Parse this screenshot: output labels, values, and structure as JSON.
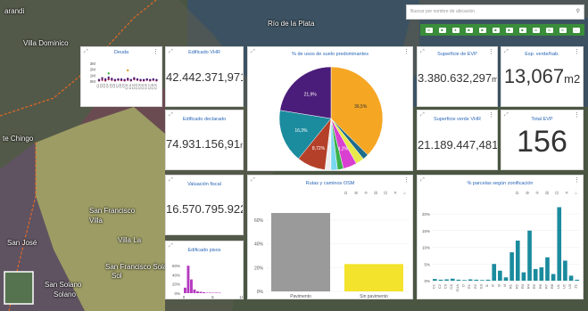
{
  "map": {
    "labels": {
      "villa_dominico": "Villa Dominico",
      "rio": "Río de la Plata",
      "tee_chingo": "te Chingo",
      "san_francisco": "San Francisco",
      "villa": "Villa",
      "arandi": "arandi",
      "san_jose": "San José",
      "villa_la": "Villa La",
      "san_francisco_solano": "San Francisco Solano",
      "san_solano": "San Solano",
      "solano": "Solano",
      "sol": "Sol"
    }
  },
  "search": {
    "placeholder": "Buscar por nombre de ubicación"
  },
  "toolbar": {
    "icons": [
      "chart-icon",
      "square-icon",
      "chat-icon",
      "square-icon",
      "square-icon",
      "square-icon",
      "square-icon",
      "square-icon",
      "chart-icon",
      "chart-icon",
      "chart-icon",
      "more-icon"
    ]
  },
  "widgets": {
    "deuda": {
      "title": "Deuda",
      "ylabels": [
        "3M",
        "2M",
        "1M",
        "0M"
      ],
      "xlabels": [
        "C1",
        "C2",
        "C3",
        "C4",
        "C5",
        "C6",
        "C7",
        "C8",
        "C9",
        "C10",
        "C11",
        "C12",
        "C13",
        "C14",
        "C15",
        "C16",
        "C17",
        "C18",
        "C19"
      ]
    },
    "edificado_vhr": {
      "title": "Edificado VHR",
      "value": "42.442.371,971",
      "unit": "m2"
    },
    "edificado_declarado": {
      "title": "Edificado declarado",
      "value": "74.931.156,91",
      "unit": "m2"
    },
    "valuacion_fiscal": {
      "title": "Valuación fiscal",
      "value": "16.570.795.922",
      "unit": "$"
    },
    "edificado_pisos": {
      "title": "Edificado pisos",
      "ylabels": [
        "60%",
        "40%",
        "20%",
        "0%"
      ],
      "xlabels": [
        "0",
        "5",
        "10"
      ]
    },
    "uso_suelo": {
      "title": "% de usos de suelo predominantes"
    },
    "superficie_evp": {
      "title": "Superficie de EVP",
      "value": "3.380.632,297",
      "unit": "m2"
    },
    "esp_verde": {
      "title": "Esp. verde/hab.",
      "value": "13,067",
      "unit": "m2"
    },
    "superficie_verde_vhr": {
      "title": "Superficie verde VHR",
      "value": "21.189.447,481",
      "unit": "m2"
    },
    "total_evp": {
      "title": "Total EVP",
      "value": "156"
    },
    "rutas": {
      "title": "Rutas y caminos OSM"
    },
    "parcelas": {
      "title": "% parcelas según zonificación"
    }
  },
  "chart_data": [
    {
      "type": "pie",
      "title": "% de usos de suelo predominantes",
      "slices": [
        {
          "label": "36,5%",
          "value": 36.5,
          "color": "#f5a623"
        },
        {
          "label": "",
          "value": 1.8,
          "color": "#1f6c8a"
        },
        {
          "label": "",
          "value": 2.5,
          "color": "#e8e84a"
        },
        {
          "label": "4,2%",
          "value": 4.2,
          "color": "#d93fd0"
        },
        {
          "label": "",
          "value": 1.8,
          "color": "#3bb04a"
        },
        {
          "label": "",
          "value": 2.0,
          "color": "#7ad7f0"
        },
        {
          "label": "",
          "value": 1.8,
          "color": "#eeeeee"
        },
        {
          "label": "8,72%",
          "value": 8.72,
          "color": "#b5402a"
        },
        {
          "label": "16,3%",
          "value": 16.3,
          "color": "#1b8b9e"
        },
        {
          "label": "21,9%",
          "value": 21.9,
          "color": "#4b1d7a"
        }
      ]
    },
    {
      "type": "bar",
      "title": "Rutas y caminos OSM",
      "categories": [
        "Pavimento",
        "Sin pavimento"
      ],
      "values": [
        66,
        23
      ],
      "colors": [
        "#9a9a9a",
        "#f4e32c"
      ],
      "yticks": [
        "0%",
        "20%",
        "40%",
        "60%"
      ],
      "ylim": [
        0,
        75
      ]
    },
    {
      "type": "bar",
      "title": "% parcelas según zonificación",
      "yticks": [
        "0%",
        "5%",
        "10%",
        "15%",
        "20%"
      ],
      "ylim": [
        0,
        24
      ],
      "categories": [
        "C1",
        "C2",
        "C3",
        "CA",
        "CUA",
        "D",
        "E1",
        "E2",
        "E3",
        "I1",
        "I2",
        "I3",
        "I4",
        "R1",
        "R2",
        "R3",
        "R4",
        "R5",
        "R6",
        "R7",
        "R8",
        "U1",
        "U2",
        "U3",
        "Z1"
      ],
      "values": [
        0.5,
        0.3,
        0.4,
        0.6,
        0.3,
        0.2,
        0.4,
        0.3,
        0.2,
        0.3,
        5.0,
        3.0,
        1.0,
        8.5,
        12.0,
        2.5,
        15.0,
        3.5,
        4.0,
        7.0,
        2.0,
        22.0,
        6.0,
        1.5,
        0.3
      ],
      "color": "#1b8b9e"
    },
    {
      "type": "bar",
      "title": "Edificado pisos",
      "yticks": [
        "0%",
        "20%",
        "40%",
        "60%"
      ],
      "ylim": [
        0,
        70
      ],
      "values": [
        12,
        60,
        30,
        8,
        4,
        3,
        2,
        1,
        1,
        1,
        1,
        1
      ],
      "color": "#b53bc0"
    },
    {
      "type": "scatter",
      "title": "Deuda",
      "ylim": [
        0,
        3
      ],
      "series": [
        {
          "color": "#9b1b4a",
          "values": [
            0.1,
            0.2,
            0.1,
            0.3,
            0.2,
            0.1,
            0.2,
            0.15,
            0.1,
            0.2,
            0.1,
            0.3,
            0.2,
            0.1,
            0.1,
            0.2,
            0.1,
            0.2,
            0.1
          ]
        },
        {
          "color": "#4b1d7a",
          "values": [
            0.2,
            0.5,
            0.3,
            0.6,
            0.4,
            0.2,
            0.3,
            0.3,
            0.2,
            0.4,
            0.2,
            0.5,
            0.3,
            0.2,
            0.2,
            0.3,
            0.2,
            0.3,
            0.2
          ]
        },
        {
          "color": "#3bb04a",
          "values": [
            0,
            0,
            0,
            1.3,
            0,
            0,
            0,
            0,
            0,
            0,
            0,
            0,
            0,
            0,
            0,
            0,
            0,
            0,
            0
          ]
        },
        {
          "color": "#e8a030",
          "values": [
            0,
            0,
            0,
            0,
            0,
            0,
            0,
            0,
            0,
            1.8,
            0,
            0,
            0,
            0,
            0,
            0,
            0,
            0,
            0
          ]
        }
      ]
    }
  ]
}
